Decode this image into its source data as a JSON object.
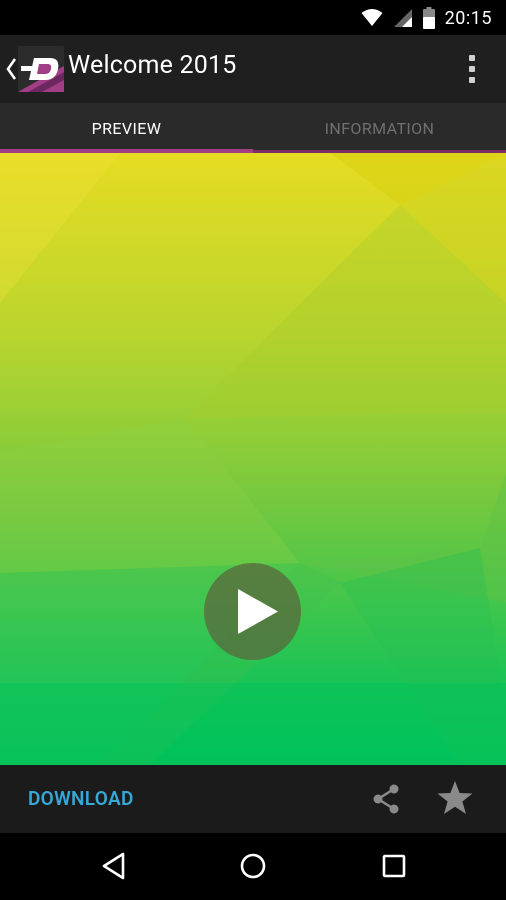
{
  "status_bar": {
    "time": "20:15",
    "icons": [
      "wifi-icon",
      "cell-signal-icon",
      "battery-icon"
    ]
  },
  "action_bar": {
    "title": "Welcome 2015",
    "back_icon": "chevron-left-icon",
    "app_icon": "zedge-logo",
    "menu_icon": "overflow-menu-icon"
  },
  "tabs": [
    {
      "label": "PREVIEW",
      "active": true
    },
    {
      "label": "INFORMATION",
      "active": false
    }
  ],
  "preview": {
    "play_icon": "play-icon"
  },
  "bottom_bar": {
    "download_label": "DOWNLOAD",
    "share_icon": "share-icon",
    "favorite_icon": "star-icon"
  },
  "nav_bar": {
    "icons": [
      "nav-back-icon",
      "nav-home-icon",
      "nav-recents-icon"
    ]
  },
  "colors": {
    "accent": "#a23e86",
    "download": "#35a8d6",
    "gradient_top": "#e8dc1f",
    "gradient_bottom": "#00c257"
  }
}
